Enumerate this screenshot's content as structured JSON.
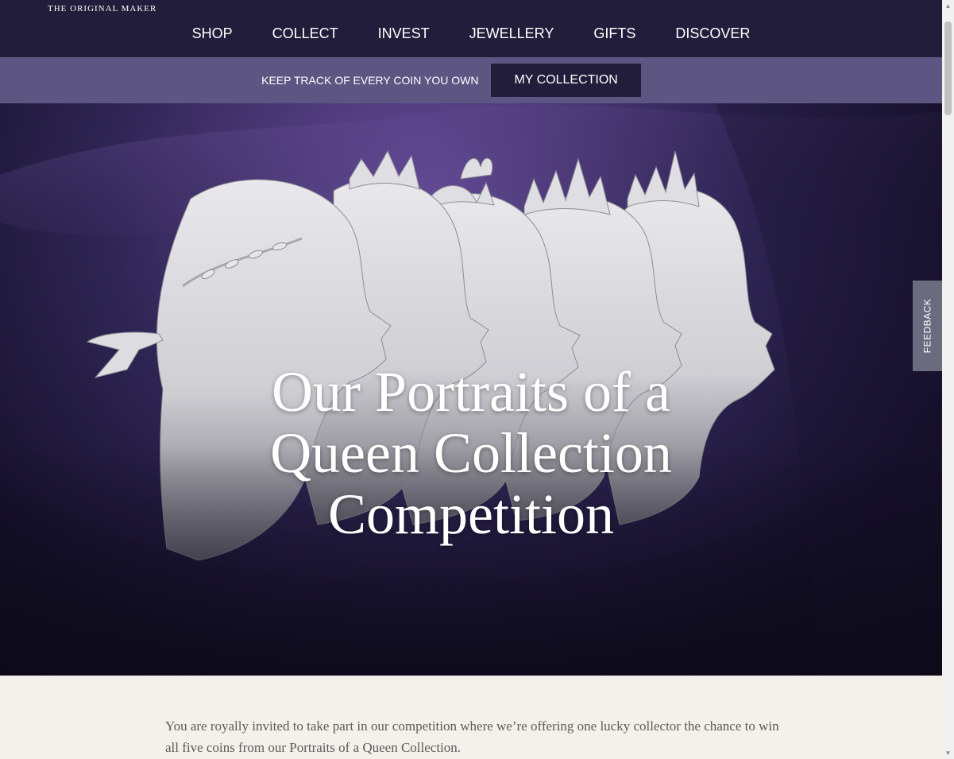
{
  "header": {
    "brand": "THE ORIGINAL MAKER",
    "nav": [
      {
        "label": "SHOP"
      },
      {
        "label": "COLLECT"
      },
      {
        "label": "INVEST"
      },
      {
        "label": "JEWELLERY"
      },
      {
        "label": "GIFTS"
      },
      {
        "label": "DISCOVER"
      }
    ]
  },
  "collection_bar": {
    "text": "KEEP TRACK OF EVERY COIN YOU OWN",
    "button": "MY COLLECTION"
  },
  "hero": {
    "title": "Our Portraits of a Queen Collection Competition"
  },
  "feedback": {
    "label": "FEEDBACK"
  },
  "intro": {
    "text": "You are royally invited to take part in our competition where we’re offering one lucky collector the chance to win all five coins from our Portraits of a Queen Collection."
  },
  "colors": {
    "nav_background": "#221d3b",
    "collection_bar_background": "#5d5683",
    "button_background": "#221d3b",
    "page_background": "#f4f0ea",
    "feedback_background": "#6b6b80"
  },
  "icons": {
    "scroll_up": "triangle-up",
    "scroll_down": "triangle-down"
  }
}
